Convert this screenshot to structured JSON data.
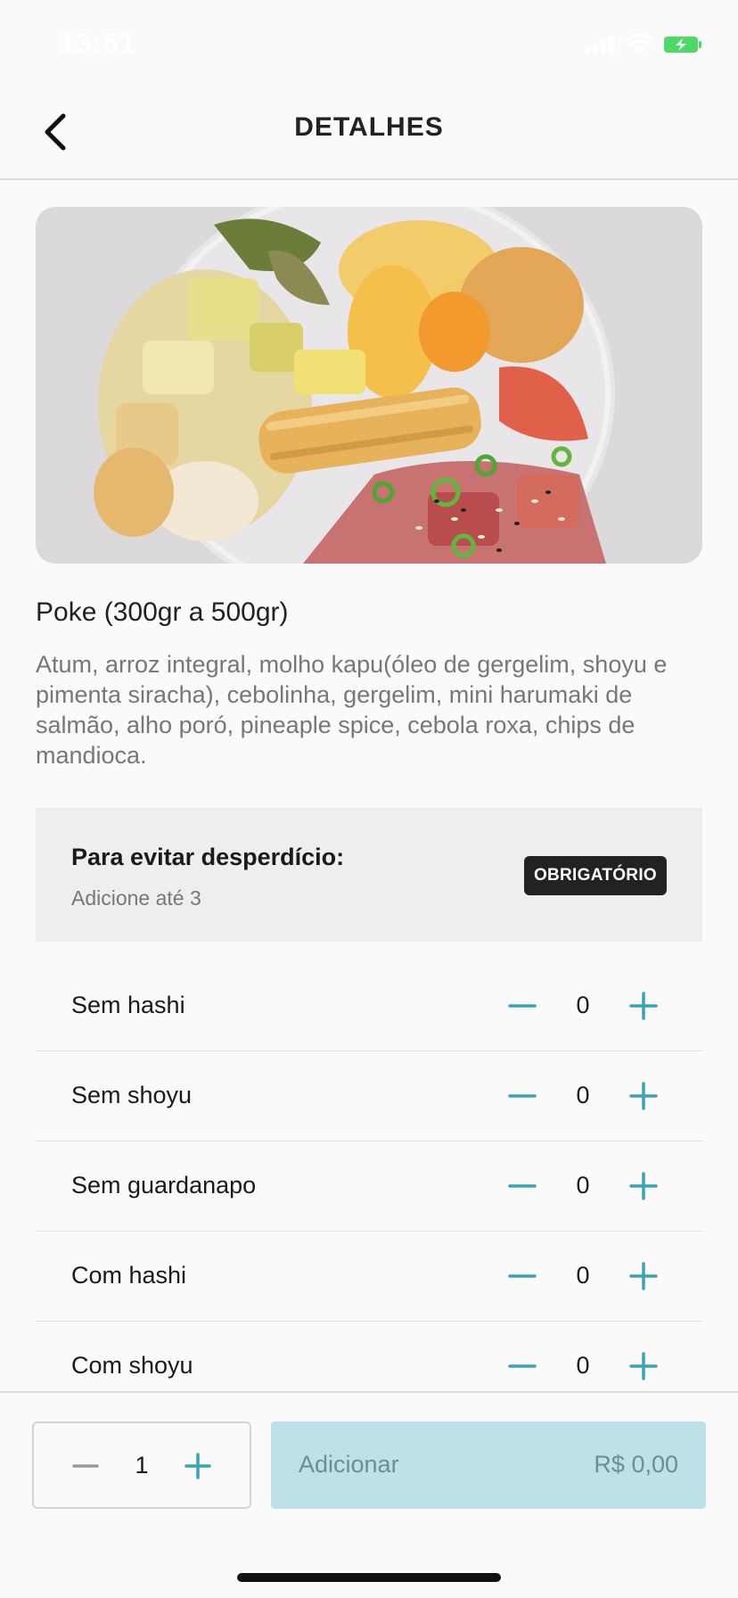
{
  "status_bar": {
    "time": "13:51",
    "icons": [
      "signal-icon",
      "wifi-icon",
      "battery-charging-icon"
    ],
    "battery_color": "#4cd964"
  },
  "header": {
    "title": "DETALHES",
    "back_icon": "chevron-left-icon"
  },
  "product": {
    "name": "Poke (300gr a 500gr)",
    "description": "Atum, arroz integral, molho kapu(óleo de gergelim, shoyu e pimenta siracha), cebolinha, gergelim, mini harumaki de salmão, alho poró, pineaple spice, cebola roxa, chips de mandioca."
  },
  "options_group": {
    "title": "Para evitar desperdício:",
    "subtitle": "Adicione até 3",
    "badge": "OBRIGATÓRIO",
    "items": [
      {
        "label": "Sem hashi",
        "value": "0"
      },
      {
        "label": "Sem shoyu",
        "value": "0"
      },
      {
        "label": "Sem guardanapo",
        "value": "0"
      },
      {
        "label": "Com hashi",
        "value": "0"
      },
      {
        "label": "Com shoyu",
        "value": "0"
      }
    ]
  },
  "footer": {
    "quantity": "1",
    "add_label": "Adicionar",
    "price": "R$ 0,00"
  },
  "colors": {
    "accent": "#3aa3b4",
    "add_button_bg": "#bce2e8",
    "badge_bg": "#222222"
  }
}
